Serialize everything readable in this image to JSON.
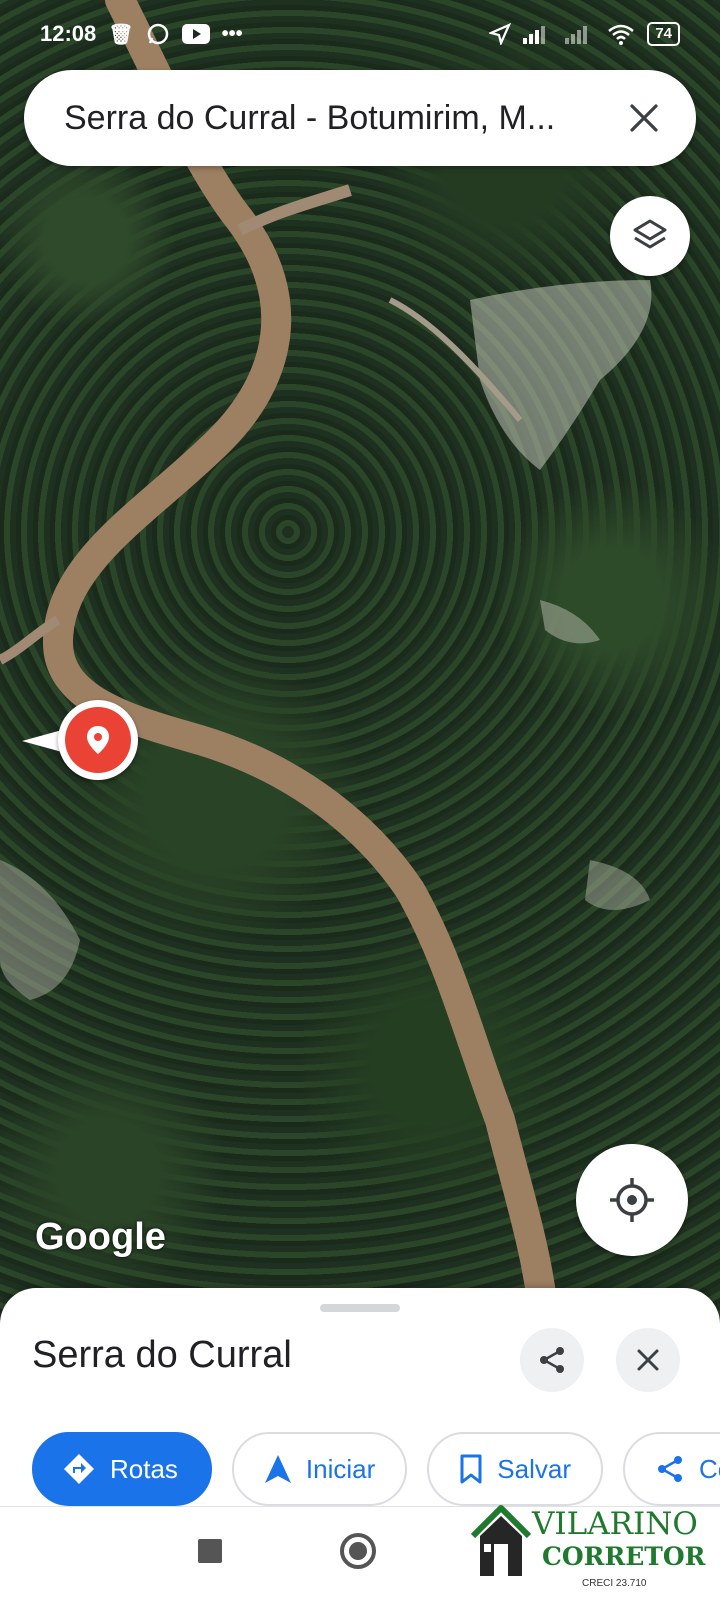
{
  "status_bar": {
    "time": "12:08",
    "notification_icons": [
      "trash-icon",
      "whatsapp-icon",
      "youtube-icon",
      "more-dots-icon"
    ],
    "battery": "74"
  },
  "search": {
    "query": "Serra do Curral - Botumirim, M..."
  },
  "map": {
    "attribution": "Google",
    "pin_color": "#ea4335"
  },
  "place": {
    "title": "Serra do Curral"
  },
  "actions": [
    {
      "label": "Rotas",
      "icon": "directions-icon"
    },
    {
      "label": "Iniciar",
      "icon": "navigation-arrow-icon"
    },
    {
      "label": "Salvar",
      "icon": "bookmark-icon"
    },
    {
      "label": "Co",
      "icon": "share-icon"
    }
  ],
  "watermark": {
    "name": "VILARINO",
    "role": "CORRETOR",
    "license": "CRECI 23.710"
  },
  "colors": {
    "accent": "#1a73e8",
    "watermark_green": "#1f7a2e"
  }
}
